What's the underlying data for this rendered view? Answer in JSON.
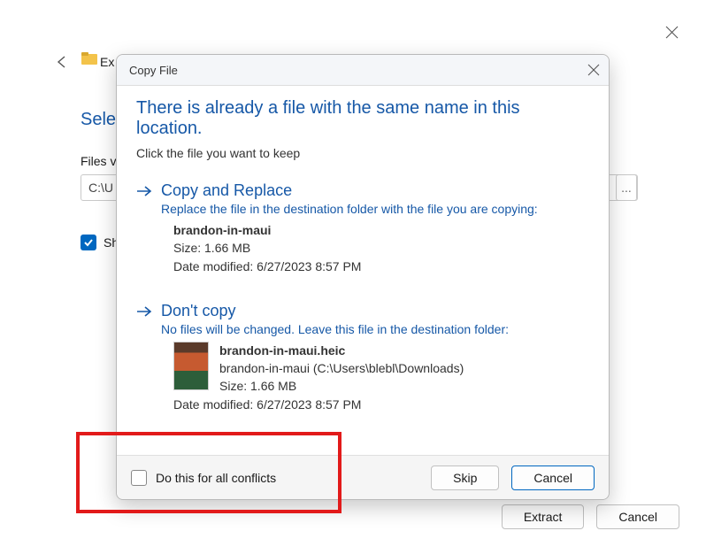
{
  "outer": {
    "title_fragment": "Ex",
    "select_label": "Sele",
    "files_label": "Files v",
    "path_fragment": "C:\\U",
    "show_label": "Sh",
    "extract_btn": "Extract",
    "cancel_btn": "Cancel",
    "browse_ellipsis": "..."
  },
  "dialog": {
    "title": "Copy File",
    "headline": "There is already a file with the same name in this location.",
    "subhead": "Click the file you want to keep",
    "option1": {
      "title": "Copy and Replace",
      "desc": "Replace the file in the destination folder with the file you are copying:",
      "file": "brandon-in-maui",
      "size": "Size: 1.66 MB",
      "modified": "Date modified: 6/27/2023 8:57 PM"
    },
    "option2": {
      "title": "Don't copy",
      "desc": "No files will be changed. Leave this file in the destination folder:",
      "file": "brandon-in-maui.heic",
      "path": "brandon-in-maui (C:\\Users\\blebl\\Downloads)",
      "size": "Size: 1.66 MB",
      "modified": "Date modified: 6/27/2023 8:57 PM"
    },
    "footer": {
      "all_conflicts": "Do this for all conflicts",
      "skip": "Skip",
      "cancel": "Cancel"
    }
  }
}
